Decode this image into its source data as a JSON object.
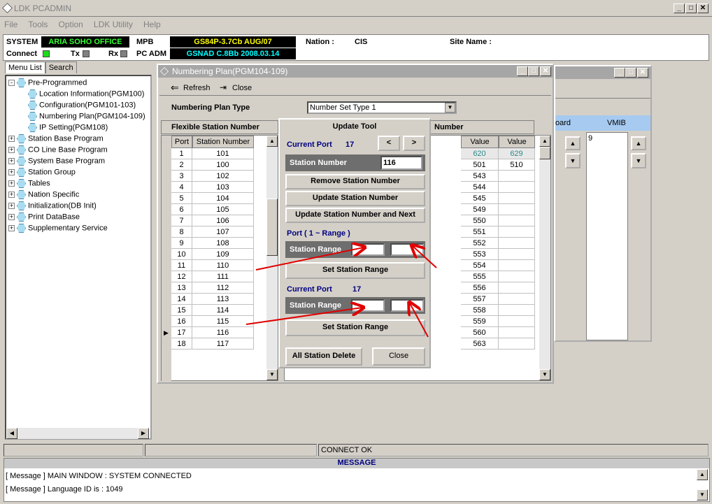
{
  "app": {
    "title": "LDK PCADMIN"
  },
  "menu": [
    "File",
    "Tools",
    "Option",
    "LDK Utility",
    "Help"
  ],
  "status": {
    "system_label": "SYSTEM",
    "system_value": "ARIA SOHO OFFICE",
    "mpb_label": "MPB",
    "mpb_value": "GS84P-3.7Cb AUG/07",
    "nation_label": "Nation :",
    "nation_value": "CIS",
    "site_label": "Site Name :",
    "connect_label": "Connect",
    "tx_label": "Tx",
    "rx_label": "Rx",
    "pcadm_label": "PC ADM",
    "pcadm_value": "GSNAD C.8Bb 2008.03.14"
  },
  "left_tabs": [
    "Menu List",
    "Search"
  ],
  "tree": [
    {
      "label": "Pre-Programmed",
      "level": 0,
      "exp": "−"
    },
    {
      "label": "Location Information(PGM100)",
      "level": 1
    },
    {
      "label": "Configuration(PGM101-103)",
      "level": 1
    },
    {
      "label": "Numbering Plan(PGM104-109)",
      "level": 1
    },
    {
      "label": "IP Setting(PGM108)",
      "level": 1
    },
    {
      "label": "Station Base Program",
      "level": 0,
      "exp": "+"
    },
    {
      "label": "CO Line Base Program",
      "level": 0,
      "exp": "+"
    },
    {
      "label": "System Base Program",
      "level": 0,
      "exp": "+"
    },
    {
      "label": "Station Group",
      "level": 0,
      "exp": "+"
    },
    {
      "label": "Tables",
      "level": 0,
      "exp": "+"
    },
    {
      "label": "Nation Specific",
      "level": 0,
      "exp": "+"
    },
    {
      "label": "Initialization(DB Init)",
      "level": 0,
      "exp": "+"
    },
    {
      "label": "Print DataBase",
      "level": 0,
      "exp": "+"
    },
    {
      "label": "Supplementary Service",
      "level": 0,
      "exp": "+"
    }
  ],
  "np": {
    "title": "Numbering Plan(PGM104-109)",
    "refresh": "Refresh",
    "close": "Close",
    "type_label": "Numbering Plan Type",
    "type_value": "Number Set Type 1",
    "flex_title": "Flexible Station Number",
    "col_port": "Port",
    "col_station": "Station Number",
    "rows": [
      [
        "1",
        "101"
      ],
      [
        "2",
        "100"
      ],
      [
        "3",
        "102"
      ],
      [
        "4",
        "103"
      ],
      [
        "5",
        "104"
      ],
      [
        "6",
        "105"
      ],
      [
        "7",
        "106"
      ],
      [
        "8",
        "107"
      ],
      [
        "9",
        "108"
      ],
      [
        "10",
        "109"
      ],
      [
        "11",
        "110"
      ],
      [
        "12",
        "111"
      ],
      [
        "13",
        "112"
      ],
      [
        "14",
        "113"
      ],
      [
        "15",
        "114"
      ],
      [
        "16",
        "115"
      ],
      [
        "17",
        "116"
      ],
      [
        "18",
        "117"
      ]
    ],
    "right_title": "Number",
    "col_value": "Value",
    "right_rows": [
      [
        "620",
        "629"
      ],
      [
        "501",
        "510"
      ],
      [
        "543",
        ""
      ],
      [
        "544",
        ""
      ],
      [
        "545",
        ""
      ],
      [
        "549",
        ""
      ],
      [
        "550",
        ""
      ],
      [
        "551",
        ""
      ],
      [
        "552",
        ""
      ],
      [
        "553",
        ""
      ],
      [
        "554",
        ""
      ],
      [
        "555",
        ""
      ],
      [
        "556",
        ""
      ],
      [
        "557",
        ""
      ],
      [
        "558",
        ""
      ],
      [
        "559",
        ""
      ],
      [
        "560",
        ""
      ],
      [
        "563",
        ""
      ]
    ]
  },
  "back_win": {
    "col1": "oard",
    "col2": "VMIB",
    "vmib_value": "9"
  },
  "update": {
    "title": "Update Tool",
    "current_port_label": "Current Port",
    "current_port_value": "17",
    "prev": "<",
    "next": ">",
    "station_number_label": "Station Number",
    "station_number_value": "116",
    "remove": "Remove Station Number",
    "update": "Update Station Number",
    "update_next": "Update Station Number and Next",
    "port_range_label": "Port ( 1 ~ Range )",
    "station_range_label": "Station Range",
    "set_range": "Set Station Range",
    "current_port2_label": "Current Port",
    "current_port2_value": "17",
    "station_range2_label": "Station Range",
    "set_range2": "Set Station Range",
    "all_delete": "All Station Delete",
    "close": "Close"
  },
  "statusline": {
    "text": "CONNECT OK"
  },
  "messages": {
    "header": "MESSAGE",
    "lines": [
      "[ Message ] MAIN WINDOW : SYSTEM CONNECTED",
      "[ Message ] Language ID is  : 1049"
    ]
  },
  "colors": {
    "grey_header": "#6e6e6e",
    "accent_text": "#000080",
    "teal_value": "#2b8a8a",
    "arrow": "#e00000"
  }
}
